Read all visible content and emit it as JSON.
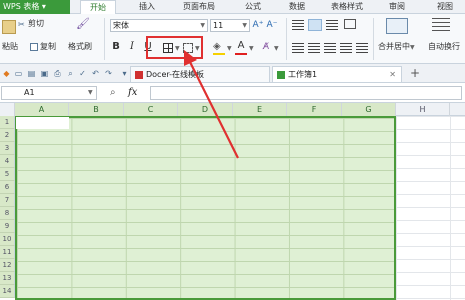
{
  "app": {
    "title": "WPS 表格"
  },
  "menu": {
    "tabs": [
      "开始",
      "插入",
      "页面布局",
      "公式",
      "数据",
      "表格样式",
      "审阅",
      "视图"
    ],
    "active": "开始"
  },
  "ribbon": {
    "cut": "剪切",
    "paste": "粘贴",
    "copy": "复制",
    "format_painter": "格式刷",
    "font_name": "宋体",
    "font_size": "11",
    "bold": "B",
    "italic": "I",
    "underline": "U",
    "font_color_glyph": "A",
    "merge_center": "合并居中",
    "auto_wrap": "自动换行"
  },
  "doc_tabs": [
    {
      "label": "Docer-在线模板"
    },
    {
      "label": "工作簿1"
    }
  ],
  "formula_bar": {
    "cell_ref": "A1",
    "fx": "fx",
    "value": ""
  },
  "grid": {
    "columns": [
      "A",
      "B",
      "C",
      "D",
      "E",
      "F",
      "G",
      "H"
    ],
    "rows": [
      "1",
      "2",
      "3",
      "4",
      "5",
      "6",
      "7",
      "8",
      "9",
      "10",
      "11",
      "12",
      "13",
      "14"
    ]
  },
  "colors": {
    "brand_green": "#3b9a3b",
    "selection_fill": "#dff0d4",
    "annotation_red": "#e03030"
  }
}
